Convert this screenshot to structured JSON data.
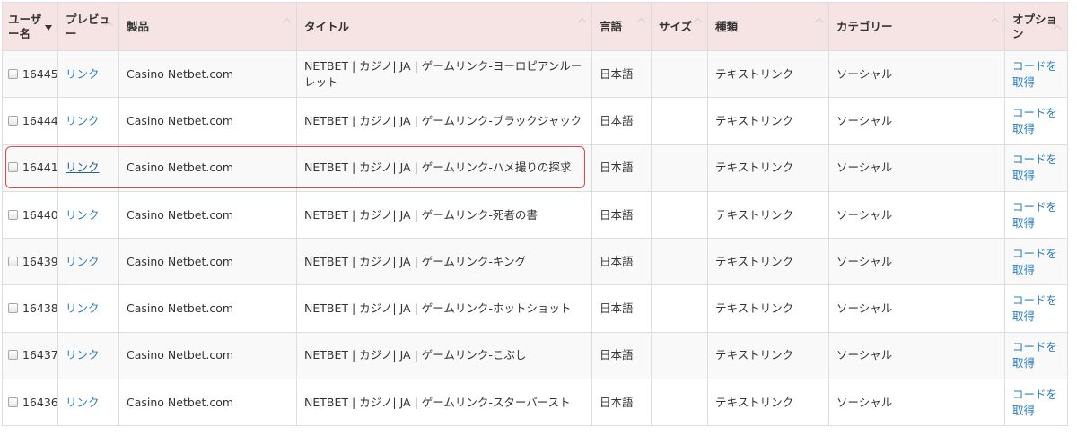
{
  "table": {
    "headers": {
      "user": "ユーザー名",
      "preview": "プレビュー",
      "product": "製品",
      "title": "タイトル",
      "language": "言語",
      "size": "サイズ",
      "kind": "種類",
      "category": "カテゴリー",
      "options": "オプション"
    },
    "rows": [
      {
        "id": "16445",
        "preview": "リンク",
        "product": "Casino Netbet.com",
        "title": "NETBET | カジノ| JA | ゲームリンク-ヨーロピアンルーレット",
        "language": "日本語",
        "size": "",
        "kind": "テキストリンク",
        "category": "ソーシャル",
        "action": "コードを取得"
      },
      {
        "id": "16444",
        "preview": "リンク",
        "product": "Casino Netbet.com",
        "title": "NETBET | カジノ| JA | ゲームリンク-ブラックジャック",
        "language": "日本語",
        "size": "",
        "kind": "テキストリンク",
        "category": "ソーシャル",
        "action": "コードを取得"
      },
      {
        "id": "16441",
        "preview": "リンク",
        "product": "Casino Netbet.com",
        "title": "NETBET | カジノ| JA | ゲームリンク-ハメ撮りの探求",
        "language": "日本語",
        "size": "",
        "kind": "テキストリンク",
        "category": "ソーシャル",
        "action": "コードを取得"
      },
      {
        "id": "16440",
        "preview": "リンク",
        "product": "Casino Netbet.com",
        "title": "NETBET | カジノ| JA | ゲームリンク-死者の書",
        "language": "日本語",
        "size": "",
        "kind": "テキストリンク",
        "category": "ソーシャル",
        "action": "コードを取得"
      },
      {
        "id": "16439",
        "preview": "リンク",
        "product": "Casino Netbet.com",
        "title": "NETBET | カジノ| JA | ゲームリンク-キング",
        "language": "日本語",
        "size": "",
        "kind": "テキストリンク",
        "category": "ソーシャル",
        "action": "コードを取得"
      },
      {
        "id": "16438",
        "preview": "リンク",
        "product": "Casino Netbet.com",
        "title": "NETBET | カジノ| JA | ゲームリンク-ホットショット",
        "language": "日本語",
        "size": "",
        "kind": "テキストリンク",
        "category": "ソーシャル",
        "action": "コードを取得"
      },
      {
        "id": "16437",
        "preview": "リンク",
        "product": "Casino Netbet.com",
        "title": "NETBET | カジノ| JA | ゲームリンク-こぶし",
        "language": "日本語",
        "size": "",
        "kind": "テキストリンク",
        "category": "ソーシャル",
        "action": "コードを取得"
      },
      {
        "id": "16436",
        "preview": "リンク",
        "product": "Casino Netbet.com",
        "title": "NETBET | カジノ| JA | ゲームリンク-スターバースト",
        "language": "日本語",
        "size": "",
        "kind": "テキストリンク",
        "category": "ソーシャル",
        "action": "コードを取得"
      }
    ]
  },
  "colors": {
    "header_bg": "#f6e3e3",
    "link": "#2a7fc4",
    "highlight_border": "#e0464a"
  }
}
